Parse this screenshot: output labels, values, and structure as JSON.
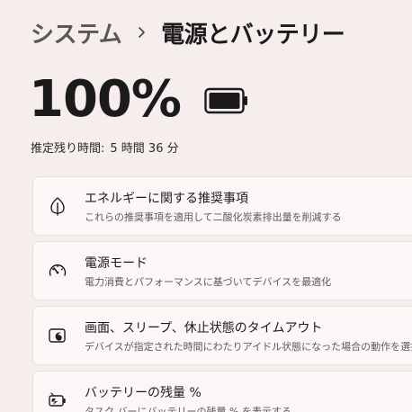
{
  "breadcrumb": {
    "parent": "システム",
    "current": "電源とバッテリー"
  },
  "battery": {
    "percent": "100%",
    "level": 1.0,
    "remaining_label": "推定残り時間:",
    "remaining_value": "5 時間 36 分"
  },
  "settings": [
    {
      "icon": "leaf-icon",
      "title": "エネルギーに関する推奨事項",
      "description": "これらの推奨事項を適用して二酸化炭素排出量を削減する"
    },
    {
      "icon": "speedometer-icon",
      "title": "電源モード",
      "description": "電力消費とパフォーマンスに基づいてデバイスを最適化"
    },
    {
      "icon": "screen-sleep-icon",
      "title": "画面、スリープ、休止状態のタイムアウト",
      "description": "デバイスが指定された時間にわたりアイドル状態になった場合の動作を選択しま"
    },
    {
      "icon": "battery-saver-icon",
      "title": "バッテリーの残量 %",
      "description": "タスク バーにバッテリーの残量 % を表示する"
    }
  ]
}
